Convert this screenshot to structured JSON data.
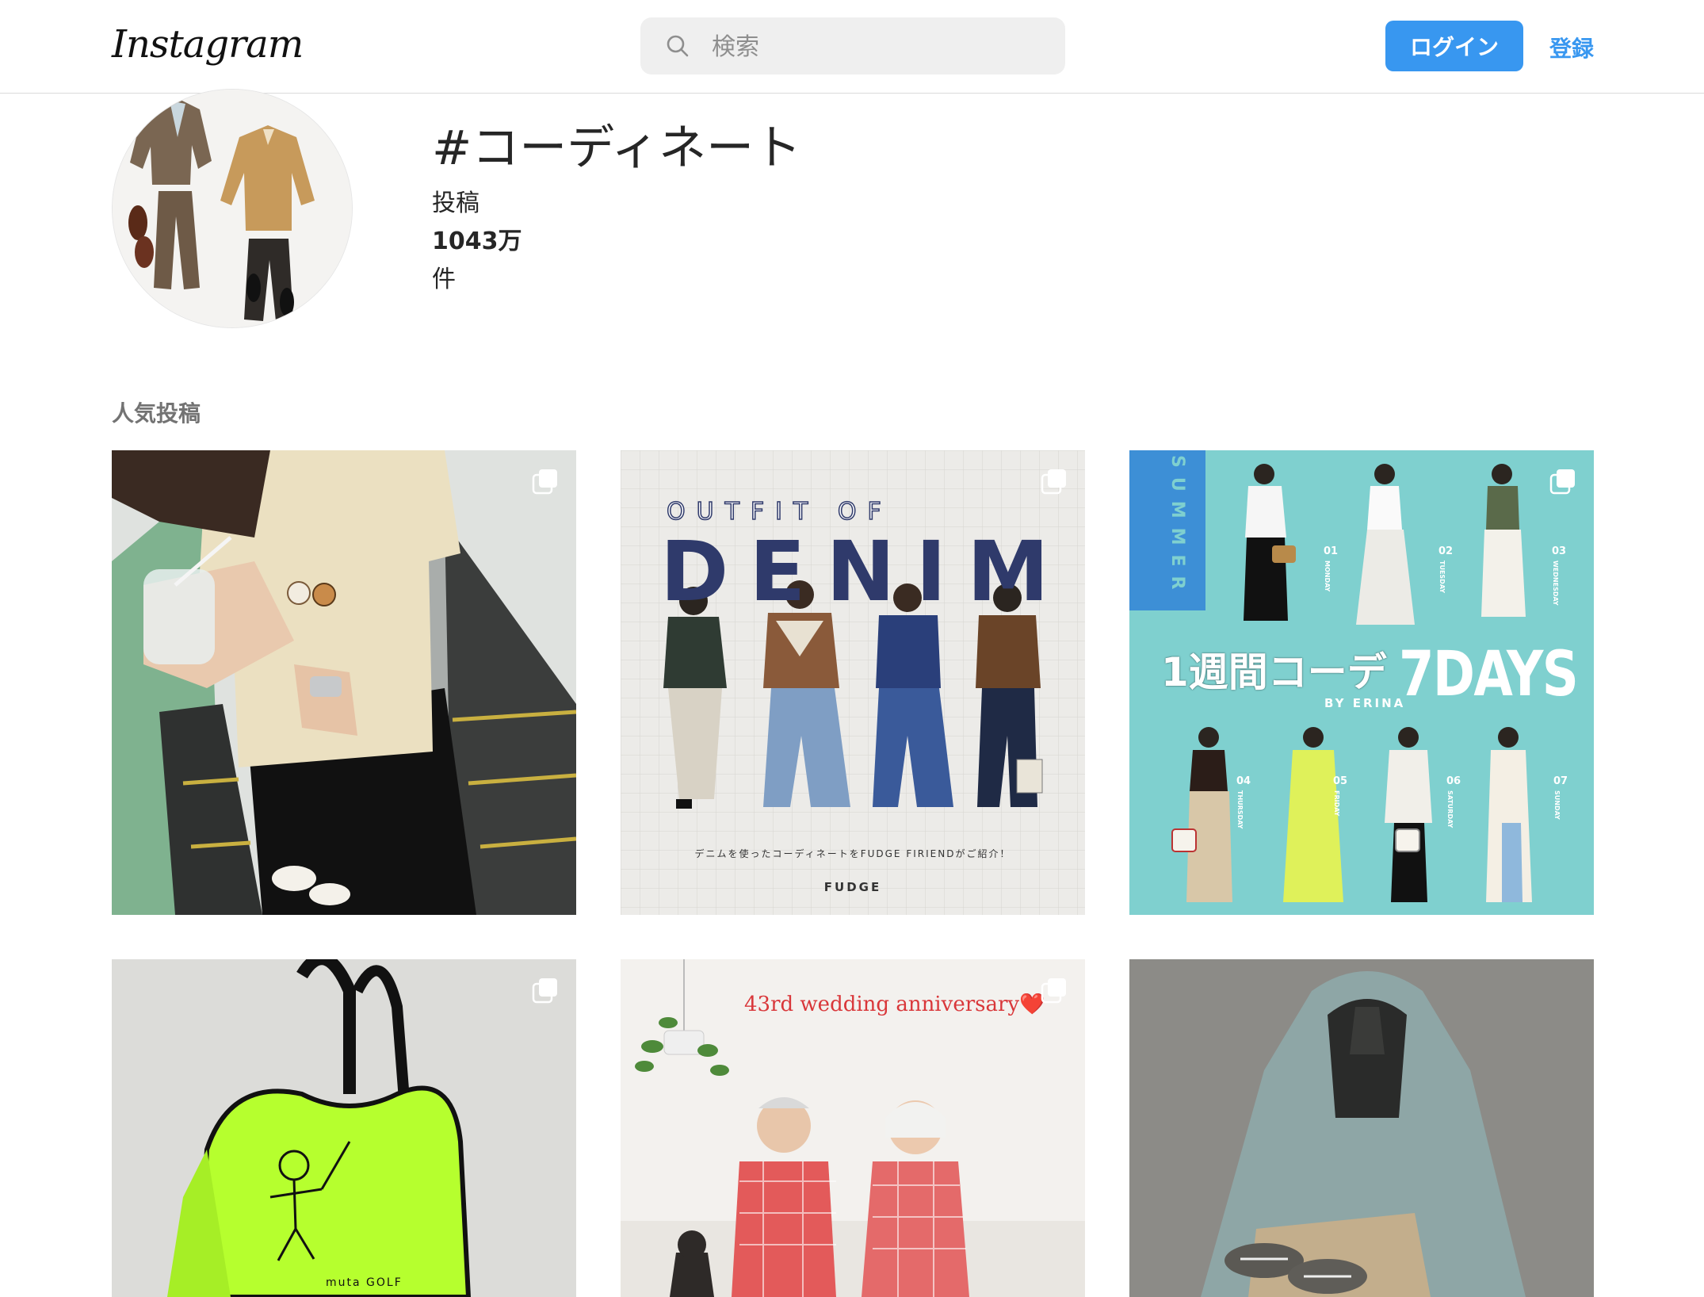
{
  "header": {
    "logo": "Instagram",
    "search_placeholder": "検索",
    "login_label": "ログイン",
    "signup_label": "登録"
  },
  "profile": {
    "hashtag": "#コーディネート",
    "posts_label": "投稿",
    "posts_count": "1043万",
    "posts_unit": "件"
  },
  "section": {
    "title": "人気投稿"
  },
  "posts": [
    {
      "kind": "photo",
      "icon": "multiple-photos-icon"
    },
    {
      "kind": "graphic",
      "icon": "multiple-photos-icon",
      "heading_small": "OUTFIT OF",
      "heading_big": "DENIM",
      "caption": "デニムを使ったコーディネートをFUDGE FIRIENDがご紹介！",
      "brand": "FUDGE"
    },
    {
      "kind": "graphic",
      "icon": "multiple-photos-icon",
      "side_label": "SUMMER",
      "headline": "1週間コーデ",
      "days": "7DAYS",
      "byline": "BY ERINA",
      "day_numbers": [
        "01",
        "02",
        "03",
        "04",
        "05",
        "06",
        "07"
      ],
      "day_names": [
        "MONDAY",
        "TUESDAY",
        "WEDNESDAY",
        "THURSDAY",
        "FRIDAY",
        "SATURDAY",
        "SUNDAY"
      ]
    },
    {
      "kind": "photo",
      "icon": "multiple-photos-icon",
      "bag_text": "muta GOLF"
    },
    {
      "kind": "photo",
      "icon": "multiple-photos-icon",
      "caption": "43rd wedding anniversary❤️"
    },
    {
      "kind": "photo",
      "icon": ""
    }
  ],
  "colors": {
    "accent": "#3897f0",
    "denim_navy": "#2f3a6b",
    "teal_bg": "#7fd0cf",
    "summer_blue": "#3d8fd6",
    "neon_green": "#b6ff2e",
    "anniversary_red": "#d9373a"
  }
}
